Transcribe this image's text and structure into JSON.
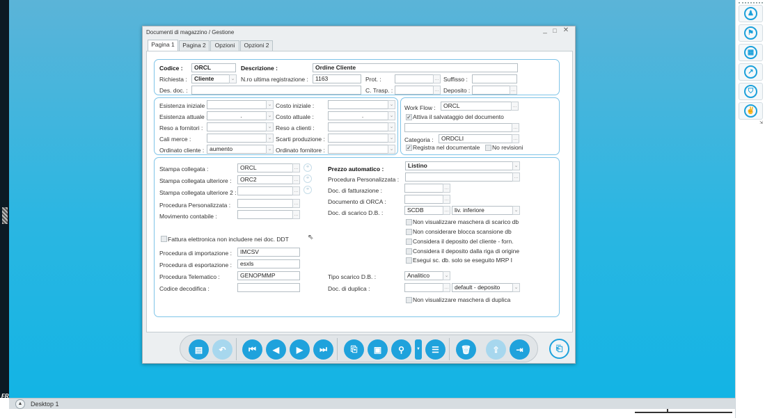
{
  "window": {
    "title": "Documenti di magazzino / Gestione"
  },
  "tabs": [
    "Pagina 1",
    "Pagina 2",
    "Opzioni",
    "Opzioni 2"
  ],
  "header": {
    "codice_label": "Codice :",
    "codice_value": "ORCL",
    "descrizione_label": "Descrizione :",
    "descrizione_value": "Ordine Cliente",
    "richiesta_label": "Richiesta :",
    "richiesta_value": "Cliente",
    "nro_label": "N.ro ultima registrazione :",
    "nro_value": "1163",
    "prot_label": "Prot. :",
    "suffisso_label": "Suffisso :",
    "desdoc_label": "Des. doc. :",
    "ctrasp_label": "C. Trasp. :",
    "deposito_label": "Deposito :"
  },
  "stock": {
    "esistenza_iniziale": "Esistenza iniziale :",
    "esistenza_attuale": "Esistenza attuale :",
    "esistenza_attuale_value": ".",
    "reso_fornitori": "Reso a fornitori :",
    "cali_merce": "Cali merce :",
    "ordinato_cliente": "Ordinato cliente :",
    "ordinato_cliente_value": "aumento",
    "costo_iniziale": "Costo iniziale :",
    "costo_attuale": "Costo attuale :",
    "costo_attuale_value": ".",
    "reso_clienti": "Reso a clienti :",
    "scarti_produzione": "Scarti produzione :",
    "ordinato_fornitore": "Ordinato fornitore :"
  },
  "workflow": {
    "label": "Work Flow :",
    "value": "ORCL",
    "attiva": "Attiva il salvataggio del documento",
    "categoria_label": "Categoria :",
    "categoria_value": "ORDCLI",
    "registra": "Registra nel documentale",
    "no_revisioni": "No revisioni"
  },
  "options": {
    "stampa_collegata": "Stampa collegata :",
    "stampa_collegata_value": "ORCL",
    "stampa_ulteriore": "Stampa collegata ulteriore :",
    "stampa_ulteriore_value": "ORC2",
    "stampa_ulteriore2": "Stampa collegata ulteriore 2 :",
    "proc_pers": "Procedura Personalizzata :",
    "movimento": "Movimento contabile :",
    "fattura": "Fattura elettronica non includere nei doc. DDT",
    "proc_import": "Procedura di importazione :",
    "proc_import_value": "IMCSV",
    "proc_export": "Procedura di esportazione :",
    "proc_export_value": "esxls",
    "proc_tele": "Procedura Telematico :",
    "proc_tele_value": "GENOPMMP",
    "codice_decodifica": "Codice decodifica :",
    "prezzo_auto": "Prezzo automatico :",
    "prezzo_auto_value": "Listino",
    "proc_pers_r": "Procedura Personalizzata :",
    "doc_fatt": "Doc. di fatturazione :",
    "doc_orca": "Documento di ORCA :",
    "doc_scarico": "Doc. di scarico D.B. :",
    "doc_scarico_value": "SCDB",
    "liv_value": "liv. inferiore",
    "chk1": "Non visualizzare maschera di scarico db",
    "chk2": "Non considerare blocca scansione db",
    "chk3": "Considera il deposito del cliente - forn.",
    "chk4": "Considera il deposito dalla riga di origine",
    "chk5": "Esegui sc. db. solo se eseguito MRP I",
    "tipo_scarico": "Tipo scarico D.B. :",
    "tipo_scarico_value": "Analitico",
    "doc_duplica": "Doc. di duplica :",
    "duplica_value": "default - deposito",
    "chk6": "Non visualizzare maschera di duplica"
  },
  "taskbar": {
    "desktop": "Desktop 1"
  },
  "left": {
    "badge": "FR"
  }
}
